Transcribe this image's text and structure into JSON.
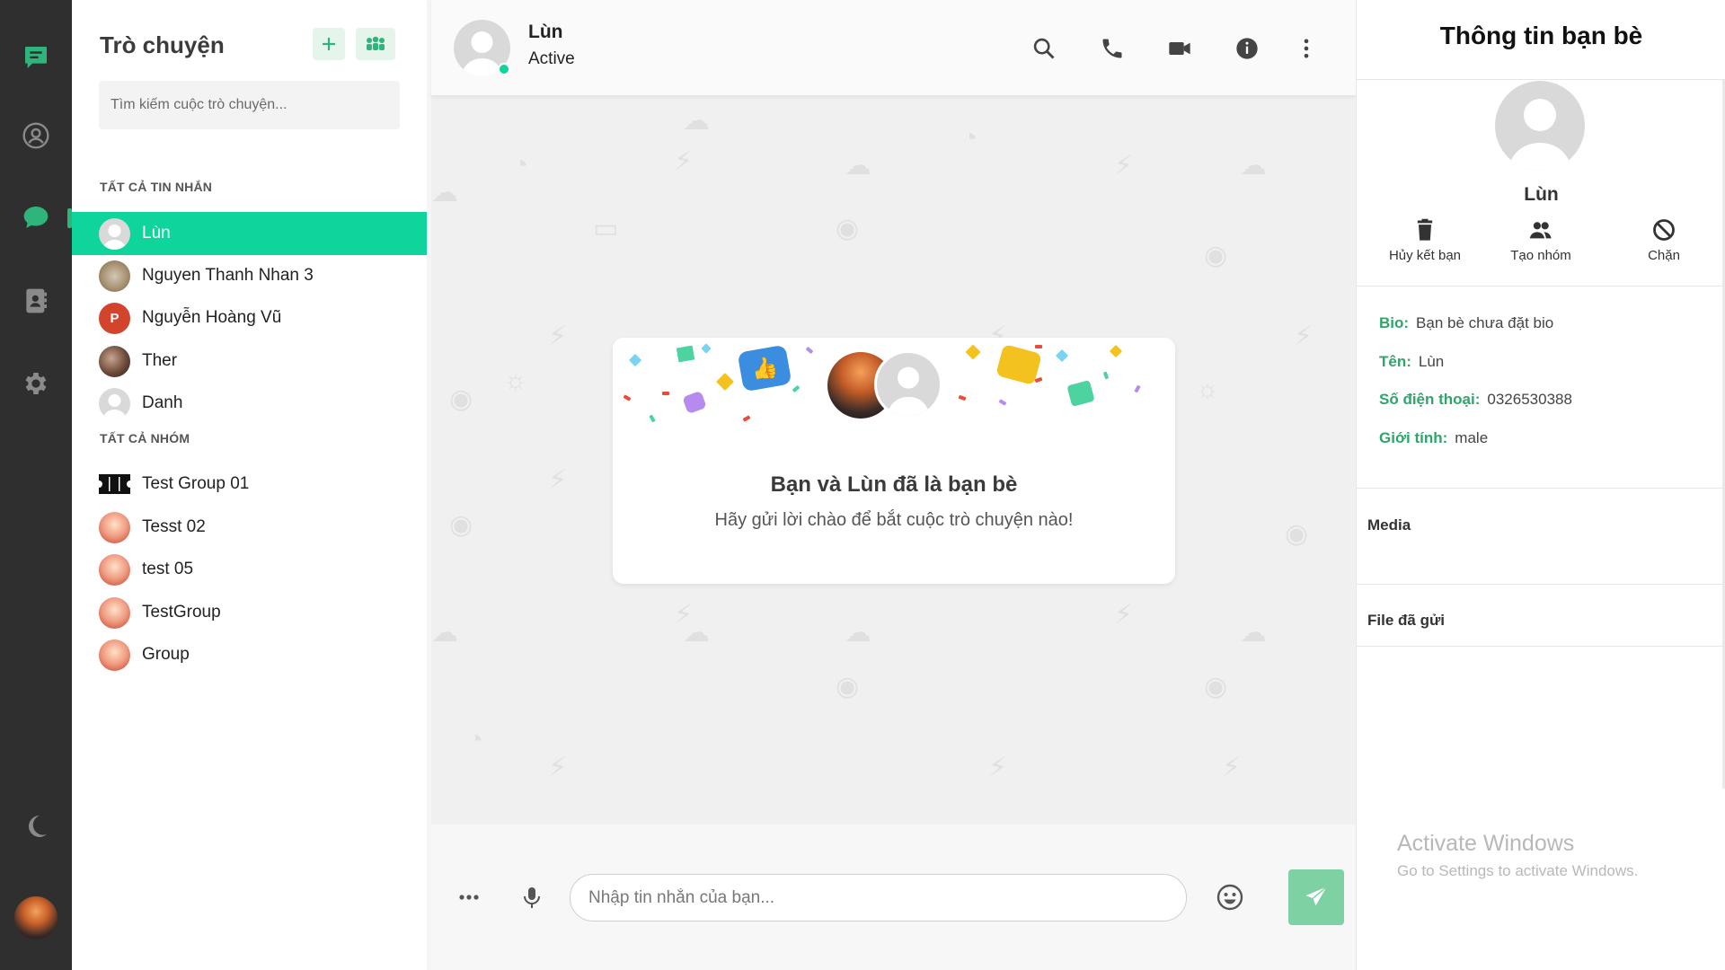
{
  "rail": {
    "items": [
      {
        "name": "messages-icon"
      },
      {
        "name": "profile-icon"
      },
      {
        "name": "chats-icon"
      },
      {
        "name": "contacts-icon"
      },
      {
        "name": "settings-icon"
      }
    ]
  },
  "list": {
    "title": "Trò chuyện",
    "search_placeholder": "Tìm kiếm cuộc trò chuyện...",
    "section_messages": "TẤT CẢ TIN NHẮN",
    "section_groups": "TẤT CẢ NHÓM",
    "conversations": [
      {
        "name": "Lùn",
        "avatar": "default"
      },
      {
        "name": "Nguyen Thanh Nhan 3",
        "avatar": "photo"
      },
      {
        "name": "Nguyễn Hoàng Vũ",
        "avatar": "ppt"
      },
      {
        "name": "Ther",
        "avatar": "photo"
      },
      {
        "name": "Danh",
        "avatar": "default"
      }
    ],
    "groups": [
      {
        "name": "Test Group 01"
      },
      {
        "name": "Tesst 02"
      },
      {
        "name": "test 05"
      },
      {
        "name": "TestGroup"
      },
      {
        "name": "Group"
      }
    ]
  },
  "chat": {
    "contact_name": "Lùn",
    "contact_status": "Active",
    "card_title": "Bạn và Lùn đã là bạn bè",
    "card_subtitle": "Hãy gửi lời chào để bắt cuộc trò chuyện nào!",
    "input_placeholder": "Nhập tin nhắn của bạn..."
  },
  "info": {
    "title": "Thông tin bạn bè",
    "name": "Lùn",
    "actions": {
      "unfriend": "Hủy kết bạn",
      "create_group": "Tạo nhóm",
      "block": "Chặn"
    },
    "bio_label": "Bio:",
    "bio_value": "Bạn bè chưa đặt bio",
    "name_label": "Tên:",
    "name_value": "Lùn",
    "phone_label": "Số điện thoại:",
    "phone_value": "0326530388",
    "gender_label": "Giới tính:",
    "gender_value": "male",
    "media_label": "Media",
    "files_label": "File đã gửi"
  },
  "watermark": {
    "line1": "Activate Windows",
    "line2": "Go to Settings to activate Windows."
  },
  "colors": {
    "accent": "#0fd49b",
    "label_green": "#2fa56b",
    "rail_bg": "#2f2f2f",
    "send_bg": "#7dd1a3"
  }
}
